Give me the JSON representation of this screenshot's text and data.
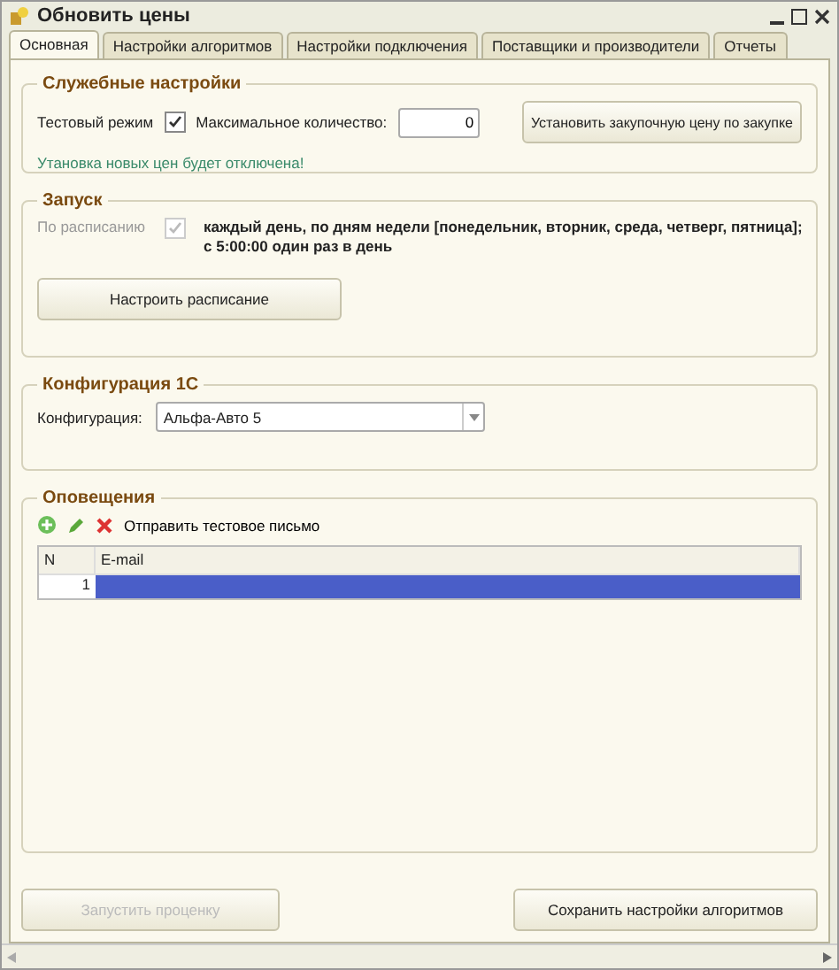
{
  "window": {
    "title": "Обновить цены"
  },
  "tabs": [
    {
      "label": "Основная",
      "selected": true
    },
    {
      "label": "Настройки алгоритмов",
      "selected": false
    },
    {
      "label": "Настройки подключения",
      "selected": false
    },
    {
      "label": "Поставщики и производители",
      "selected": false
    },
    {
      "label": "Отчеты",
      "selected": false
    }
  ],
  "service": {
    "title": "Служебные настройки",
    "test_mode": {
      "label": "Тестовый режим",
      "checked": true
    },
    "max_qty": {
      "label": "Максимальное количество:",
      "value": "0"
    },
    "set_price_button": "Установить закупочную цену по закупке",
    "note": "Утановка новых цен будет отключена!"
  },
  "launch": {
    "title": "Запуск",
    "schedule": {
      "label": "По расписанию",
      "checked": true,
      "disabled": true
    },
    "schedule_text": "каждый день, по дням недели [понедельник, вторник, среда, четверг, пятница];\nс 5:00:00 один раз в день",
    "configure_button": "Настроить расписание"
  },
  "config": {
    "title": "Конфигурация 1С",
    "label": "Конфигурация:",
    "value": "Альфа-Авто 5"
  },
  "notifications": {
    "title": "Оповещения",
    "send_test": "Отправить тестовое письмо",
    "table": {
      "columns": [
        "N",
        "E-mail"
      ],
      "rows": [
        {
          "n": "1",
          "selected": true
        }
      ]
    }
  },
  "buttons": [
    {
      "label": "Запустить проценку",
      "disabled": true
    },
    {
      "label": "Сохранить настройки алгоритмов",
      "disabled": false
    }
  ]
}
